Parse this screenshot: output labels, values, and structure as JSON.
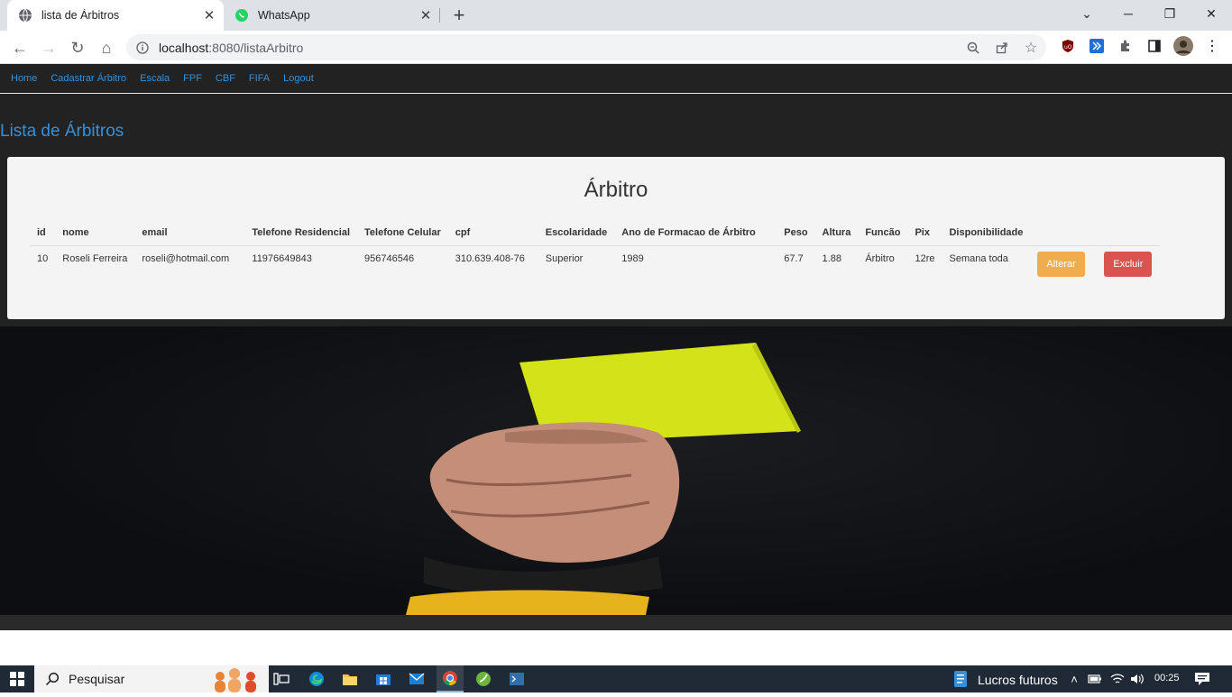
{
  "browser": {
    "tabs": [
      {
        "title": "lista de Árbitros",
        "icon": "globe-icon"
      },
      {
        "title": "WhatsApp",
        "icon": "whatsapp-icon"
      }
    ],
    "url_host": "localhost",
    "url_rest": ":8080/listaArbitro"
  },
  "nav": {
    "items": [
      "Home",
      "Cadastrar Árbitro",
      "Escala",
      "FPF",
      "CBF",
      "FIFA",
      "Logout"
    ]
  },
  "page": {
    "title": "Lista de Árbitros",
    "panel_title": "Árbitro"
  },
  "table": {
    "headers": [
      "id",
      "nome",
      "email",
      "Telefone Residencial",
      "Telefone Celular",
      "cpf",
      "Escolaridade",
      "Ano de Formacao de Árbitro",
      "Peso",
      "Altura",
      "Funcão",
      "Pix",
      "Disponibilidade"
    ],
    "rows": [
      {
        "id": "10",
        "nome": "Roseli Ferreira",
        "email": "roseli@hotmail.com",
        "tel_res": "11976649843",
        "tel_cel": "956746546",
        "cpf": "310.639.408-76",
        "escolaridade": "Superior",
        "ano": "1989",
        "peso": "67.7",
        "altura": "1.88",
        "funcao": "Árbitro",
        "pix": "12re",
        "disponibilidade": "Semana toda",
        "alterar_label": "Alterar",
        "excluir_label": "Excluir"
      }
    ]
  },
  "taskbar": {
    "search_placeholder": "Pesquisar",
    "widget_label": "Lucros futuros",
    "time": "00:25"
  },
  "colors": {
    "link": "#3a8fd4",
    "warning": "#f0ad4e",
    "danger": "#d9534f",
    "card": "#d4e21a"
  }
}
